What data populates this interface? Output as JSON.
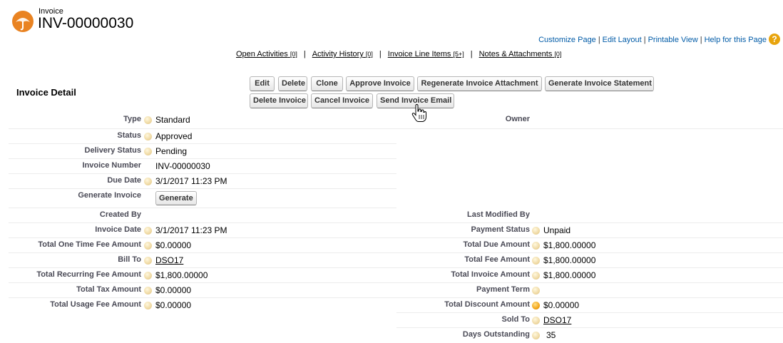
{
  "header": {
    "object_type": "Invoice",
    "record_name": "INV-00000030"
  },
  "top_links": {
    "customize_page": "Customize Page",
    "edit_layout": "Edit Layout",
    "printable_view": "Printable View",
    "help": "Help for this Page",
    "separator": "|"
  },
  "related_links": [
    {
      "label": "Open Activities",
      "count": "[0]"
    },
    {
      "label": "Activity History",
      "count": "[0]"
    },
    {
      "label": "Invoice Line Items",
      "count": "[5+]"
    },
    {
      "label": "Notes & Attachments",
      "count": "[0]"
    }
  ],
  "section": {
    "title": "Invoice Detail"
  },
  "buttons": {
    "edit": "Edit",
    "delete": "Delete",
    "clone": "Clone",
    "approve_invoice": "Approve Invoice",
    "regenerate_attachment": "Regenerate Invoice Attachment",
    "generate_statement": "Generate Invoice Statement",
    "delete_invoice": "Delete Invoice",
    "cancel_invoice": "Cancel Invoice",
    "send_invoice_email": "Send Invoice Email"
  },
  "fields": {
    "type": {
      "label": "Type",
      "value": "Standard"
    },
    "owner": {
      "label": "Owner",
      "value": ""
    },
    "status": {
      "label": "Status",
      "value": "Approved"
    },
    "delivery_status": {
      "label": "Delivery Status",
      "value": "Pending"
    },
    "invoice_number": {
      "label": "Invoice Number",
      "value": "INV-00000030"
    },
    "due_date": {
      "label": "Due Date",
      "value": "3/1/2017 11:23 PM"
    },
    "generate_invoice": {
      "label": "Generate Invoice",
      "button": "Generate"
    },
    "created_by": {
      "label": "Created By",
      "value": ""
    },
    "last_modified_by": {
      "label": "Last Modified By",
      "value": ""
    },
    "invoice_date": {
      "label": "Invoice Date",
      "value": "3/1/2017 11:23 PM"
    },
    "payment_status": {
      "label": "Payment Status",
      "value": "Unpaid"
    },
    "total_one_time_fee": {
      "label": "Total One Time Fee Amount",
      "value": "$0.00000"
    },
    "total_due": {
      "label": "Total Due Amount",
      "value": "$1,800.00000"
    },
    "bill_to": {
      "label": "Bill To",
      "value": "DSO17"
    },
    "total_fee": {
      "label": "Total Fee Amount",
      "value": "$1,800.00000"
    },
    "total_recurring_fee": {
      "label": "Total Recurring Fee Amount",
      "value": "$1,800.00000"
    },
    "total_invoice": {
      "label": "Total Invoice Amount",
      "value": "$1,800.00000"
    },
    "total_tax": {
      "label": "Total Tax Amount",
      "value": "$0.00000"
    },
    "payment_term": {
      "label": "Payment Term",
      "value": ""
    },
    "total_usage_fee": {
      "label": "Total Usage Fee Amount",
      "value": "$0.00000"
    },
    "total_discount": {
      "label": "Total Discount Amount",
      "value": "$0.00000"
    },
    "sold_to": {
      "label": "Sold To",
      "value": "DSO17"
    },
    "days_outstanding": {
      "label": "Days Outstanding",
      "value": "35"
    }
  },
  "colors": {
    "link_blue": "#015ba7",
    "label_gray": "#4a4a56",
    "help_orange": "#e8a40d",
    "logo_orange": "#e98322"
  }
}
